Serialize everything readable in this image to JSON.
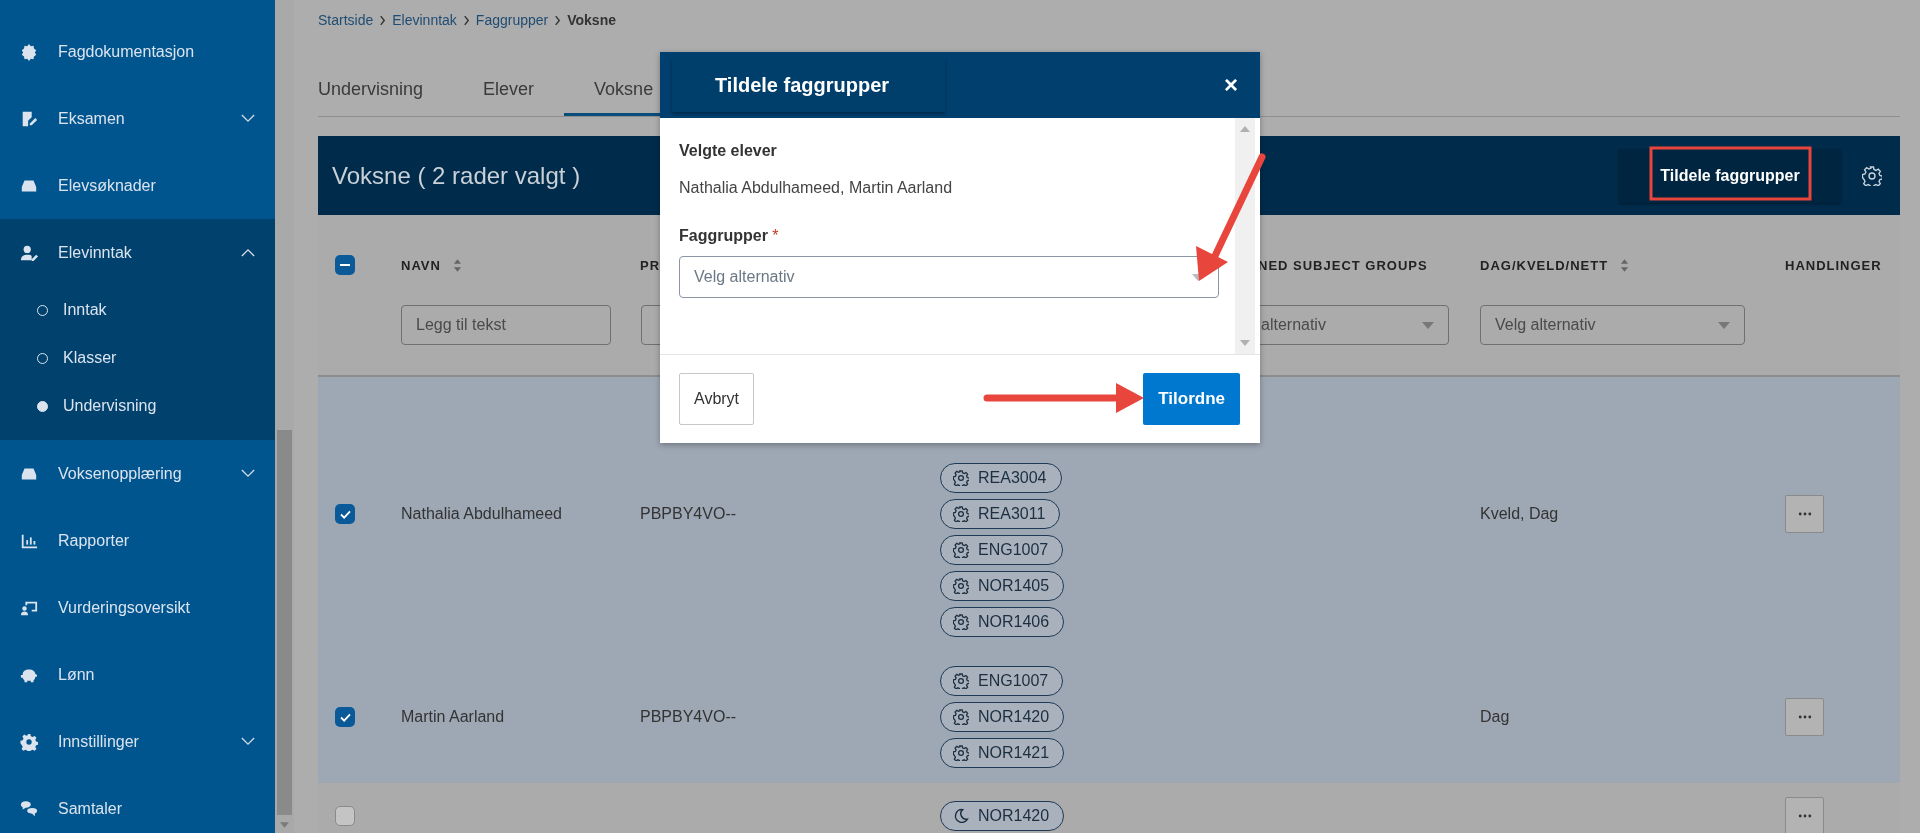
{
  "sidebar": {
    "items": [
      {
        "label": "Fagdokumentasjon"
      },
      {
        "label": "Eksamen",
        "expanded": false
      },
      {
        "label": "Elevsøknader"
      },
      {
        "label": "Elevinntak",
        "expanded": true,
        "children": [
          {
            "label": "Inntak",
            "selected": false
          },
          {
            "label": "Klasser",
            "selected": false
          },
          {
            "label": "Undervisning",
            "selected": true
          }
        ]
      },
      {
        "label": "Voksenopplæring",
        "expanded": false
      },
      {
        "label": "Rapporter"
      },
      {
        "label": "Vurderingsoversikt"
      },
      {
        "label": "Lønn"
      },
      {
        "label": "Innstillinger",
        "expanded": false
      },
      {
        "label": "Samtaler"
      }
    ]
  },
  "breadcrumb": [
    "Startside",
    "Elevinntak",
    "Faggrupper",
    "Voksne"
  ],
  "tabs": [
    {
      "label": "Undervisning",
      "selected": false
    },
    {
      "label": "Elever",
      "selected": false
    },
    {
      "label": "Voksne",
      "selected": true
    }
  ],
  "panel": {
    "title": "Voksne ( 2 rader valgt )",
    "action": "Tildele faggrupper"
  },
  "table": {
    "select_all": {
      "checked": true,
      "partial": true
    },
    "columns": [
      {
        "label": "NAVN",
        "sortable": true
      },
      {
        "label": "PR",
        "sortable": false
      },
      {
        "label": "NED SUBJECT GROUPS",
        "sortable": false
      },
      {
        "label": "DAG/KVELD/NETT",
        "sortable": true
      },
      {
        "label": "HANDLINGER",
        "sortable": false
      }
    ],
    "filters": [
      {
        "kind": "text",
        "placeholder": "Legg til tekst"
      },
      {
        "kind": "text"
      },
      {
        "kind": "select",
        "placeholder": "alternativ"
      },
      {
        "kind": "select",
        "placeholder": "Velg alternativ"
      }
    ],
    "rows": [
      {
        "checked": true,
        "selected": true,
        "name": "Nathalia Abdulhameed",
        "program": "PBPBY4VO--",
        "time": "Kveld, Dag",
        "groups": [
          {
            "code": "REA3004",
            "kind": "gear"
          },
          {
            "code": "REA3011",
            "kind": "gear"
          },
          {
            "code": "ENG1007",
            "kind": "gear"
          },
          {
            "code": "NOR1405",
            "kind": "gear"
          },
          {
            "code": "NOR1406",
            "kind": "gear"
          }
        ]
      },
      {
        "checked": true,
        "selected": true,
        "name": "Martin Aarland",
        "program": "PBPBY4VO--",
        "time": "Dag",
        "groups": [
          {
            "code": "ENG1007",
            "kind": "gear"
          },
          {
            "code": "NOR1420",
            "kind": "gear"
          },
          {
            "code": "NOR1421",
            "kind": "gear"
          }
        ]
      },
      {
        "checked": false,
        "selected": false,
        "groups": [
          {
            "code": "NOR1420",
            "kind": "moon"
          }
        ]
      }
    ]
  },
  "modal": {
    "title": "Tildele faggrupper",
    "close": "×",
    "selected_label": "Velgte elever",
    "selected_names": "Nathalia Abdulhameed, Martin Aarland",
    "field_label": "Faggrupper",
    "required": "*",
    "field_placeholder": "Velg alternativ",
    "cancel": "Avbryt",
    "confirm": "Tilordne"
  }
}
